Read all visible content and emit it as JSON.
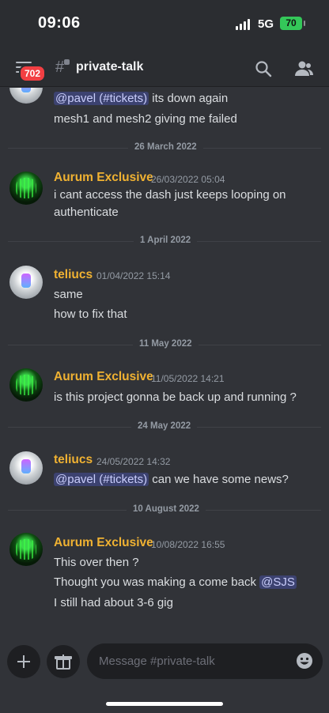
{
  "status_bar": {
    "time": "09:06",
    "network": "5G",
    "battery": "70"
  },
  "header": {
    "unread_badge": "702",
    "channel_name": "private-talk"
  },
  "messages": {
    "m0": {
      "line1_mention": "@pavel (#tickets)",
      "line1_text": " its down again",
      "line2": "mesh1 and mesh2 giving me failed"
    },
    "d1": "26 March 2022",
    "m1": {
      "author": "Aurum Exclusive",
      "time": "26/03/2022 05:04",
      "line1": "i cant access the dash just keeps looping on",
      "line2": "authenticate"
    },
    "d2": "1 April 2022",
    "m2": {
      "author": "teliucs",
      "time": "01/04/2022 15:14",
      "line1": "same",
      "line2": "how to fix that"
    },
    "d3": "11 May 2022",
    "m3": {
      "author": "Aurum Exclusive",
      "time": "11/05/2022 14:21",
      "line1": "is this project gonna be back up and running ?"
    },
    "d4": "24 May 2022",
    "m4": {
      "author": "teliucs",
      "time": "24/05/2022 14:32",
      "line1_mention": "@pavel (#tickets)",
      "line1_text": " can we have some news?"
    },
    "d5": "10 August 2022",
    "m5": {
      "author": "Aurum Exclusive",
      "time": "10/08/2022 16:55",
      "line1": "This over then ?",
      "line2_text": "Thought you was making a come back ",
      "line2_mention": "@SJS",
      "line3": "I still had about 3-6 gig"
    }
  },
  "composer": {
    "placeholder": "Message #private-talk"
  },
  "icons": {
    "menu": "hamburger-icon",
    "channel": "hashtag-lock-icon",
    "search": "search-icon",
    "members": "members-icon",
    "plus": "plus-icon",
    "gift": "gift-icon",
    "emoji": "emoji-icon"
  },
  "colors": {
    "background": "#313338",
    "username": "#f0b232",
    "mention_bg": "#3c4270",
    "badge": "#f23f43"
  }
}
